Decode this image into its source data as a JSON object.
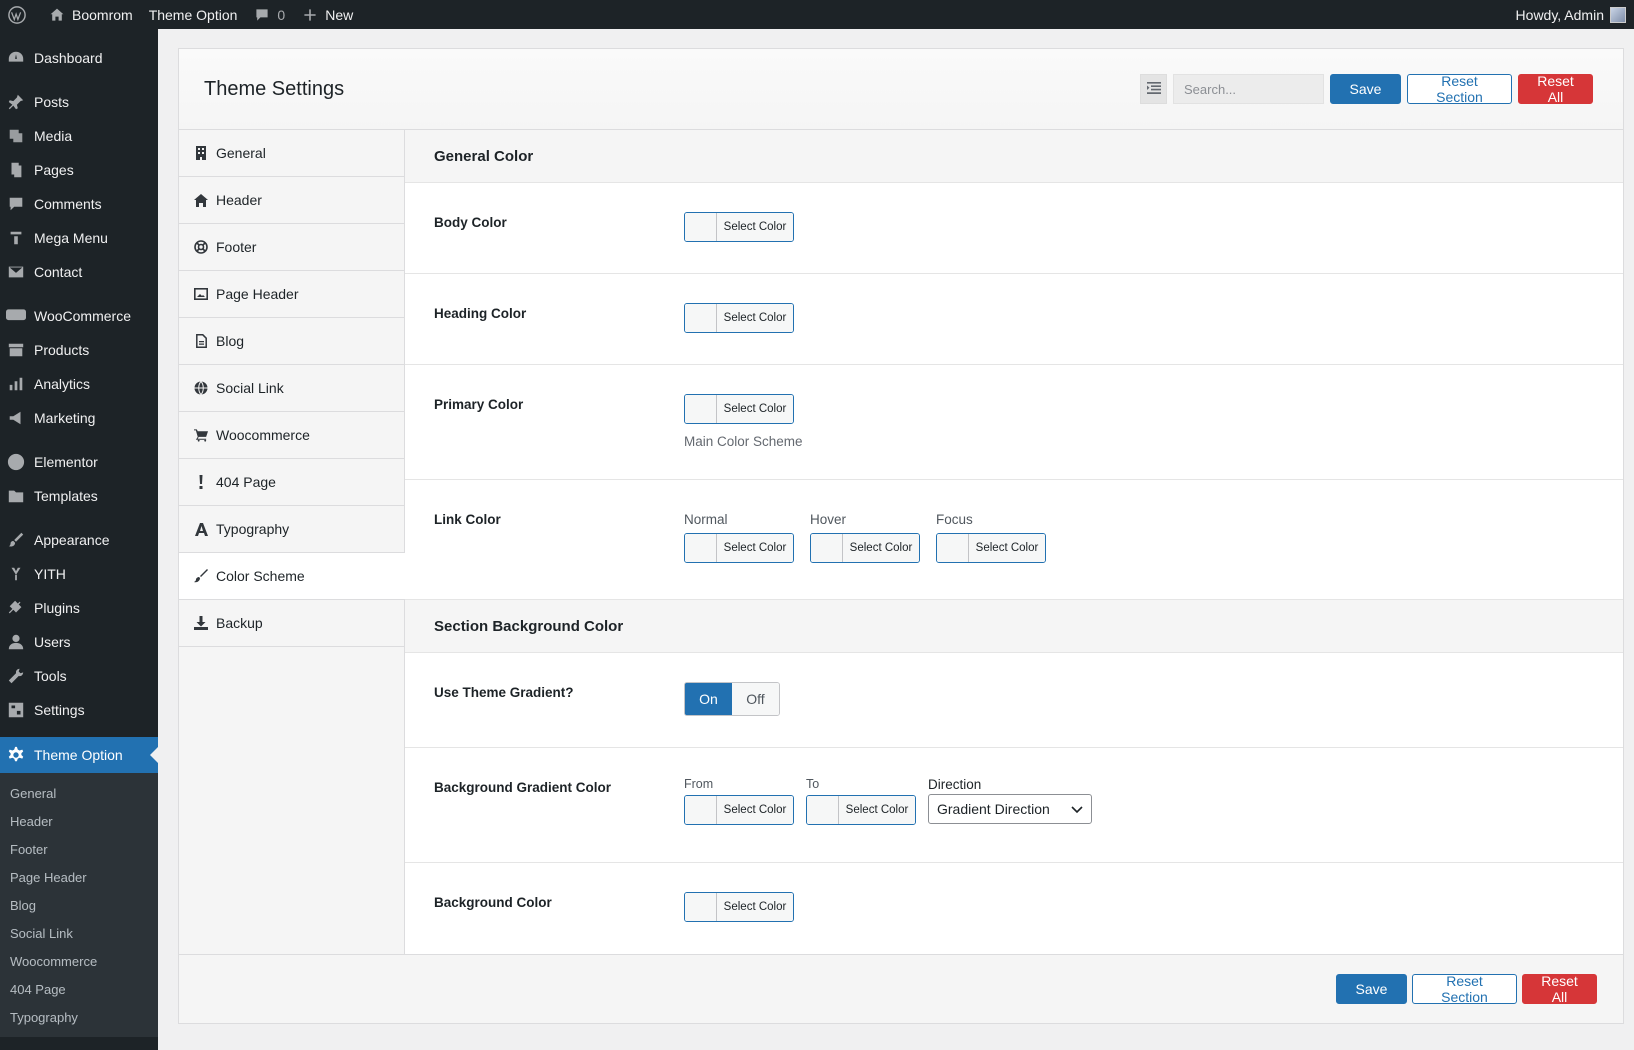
{
  "adminbar": {
    "site_name": "Boomrom",
    "theme_option": "Theme Option",
    "comments_count": "0",
    "new_label": "New",
    "howdy": "Howdy, Admin"
  },
  "menu": {
    "items": [
      {
        "label": "Dashboard",
        "icon": "dashboard-icon"
      },
      {
        "label": "Posts",
        "icon": "pin-icon"
      },
      {
        "label": "Media",
        "icon": "media-icon"
      },
      {
        "label": "Pages",
        "icon": "pages-icon"
      },
      {
        "label": "Comments",
        "icon": "comments-icon"
      },
      {
        "label": "Mega Menu",
        "icon": "mega-menu-icon"
      },
      {
        "label": "Contact",
        "icon": "mail-icon"
      },
      {
        "label": "WooCommerce",
        "icon": "woo-icon"
      },
      {
        "label": "Products",
        "icon": "archive-icon"
      },
      {
        "label": "Analytics",
        "icon": "bar-chart-icon"
      },
      {
        "label": "Marketing",
        "icon": "megaphone-icon"
      },
      {
        "label": "Elementor",
        "icon": "elementor-icon"
      },
      {
        "label": "Templates",
        "icon": "folder-icon"
      },
      {
        "label": "Appearance",
        "icon": "brush-icon"
      },
      {
        "label": "YITH",
        "icon": "yith-icon"
      },
      {
        "label": "Plugins",
        "icon": "plug-icon"
      },
      {
        "label": "Users",
        "icon": "user-icon"
      },
      {
        "label": "Tools",
        "icon": "wrench-icon"
      },
      {
        "label": "Settings",
        "icon": "settings-icon"
      },
      {
        "label": "Theme Option",
        "icon": "gear-icon"
      }
    ],
    "submenu": [
      "General",
      "Header",
      "Footer",
      "Page Header",
      "Blog",
      "Social Link",
      "Woocommerce",
      "404 Page",
      "Typography"
    ]
  },
  "panel": {
    "title": "Theme Settings",
    "search_placeholder": "Search...",
    "save": "Save",
    "reset_section": "Reset Section",
    "reset_all": "Reset All"
  },
  "sections": [
    {
      "label": "General",
      "icon": "building-icon"
    },
    {
      "label": "Header",
      "icon": "home-icon"
    },
    {
      "label": "Footer",
      "icon": "lifebuoy-icon"
    },
    {
      "label": "Page Header",
      "icon": "image-icon"
    },
    {
      "label": "Blog",
      "icon": "document-icon"
    },
    {
      "label": "Social Link",
      "icon": "globe-icon"
    },
    {
      "label": "Woocommerce",
      "icon": "cart-icon"
    },
    {
      "label": "404 Page",
      "icon": "exclamation-icon"
    },
    {
      "label": "Typography",
      "icon": "font-icon"
    },
    {
      "label": "Color Scheme",
      "icon": "paintbrush-icon"
    },
    {
      "label": "Backup",
      "icon": "download-icon"
    }
  ],
  "content": {
    "general_color_heading": "General Color",
    "select_color": "Select Color",
    "body_color": "Body Color",
    "heading_color": "Heading Color",
    "primary_color": "Primary Color",
    "primary_desc": "Main Color Scheme",
    "link_color": "Link Color",
    "link_normal": "Normal",
    "link_hover": "Hover",
    "link_focus": "Focus",
    "section_bg_heading": "Section Background Color",
    "use_gradient": "Use Theme Gradient?",
    "toggle_on": "On",
    "toggle_off": "Off",
    "bg_gradient": "Background Gradient Color",
    "from": "From",
    "to": "To",
    "direction": "Direction",
    "direction_value": "Gradient Direction",
    "bg_color": "Background Color"
  },
  "colors": {
    "admin_dark": "#1d2327",
    "accent": "#2271b1",
    "danger": "#d63638"
  }
}
